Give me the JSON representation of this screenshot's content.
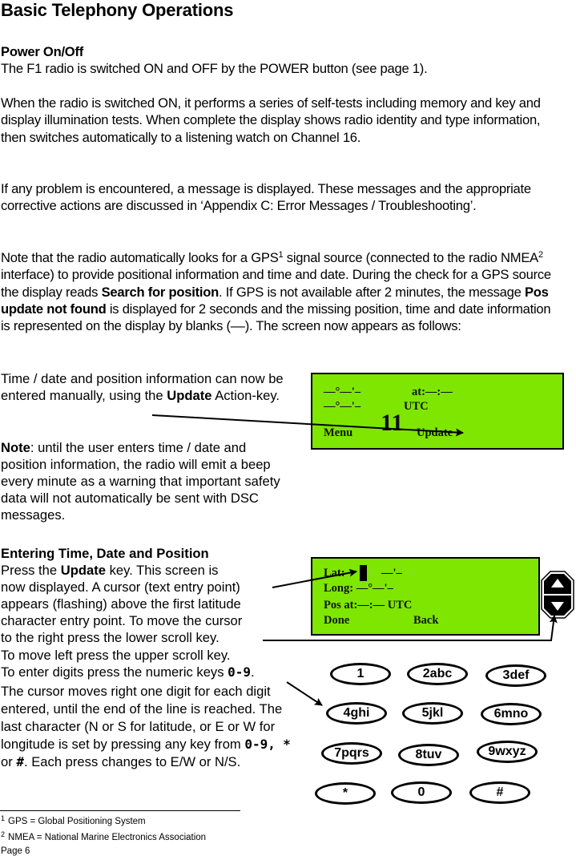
{
  "page": {
    "title": "Basic Telephony Operations",
    "page_number": "Page 6"
  },
  "power": {
    "heading": "Power On/Off",
    "p1": "The F1 radio is switched ON and OFF by the POWER button (see page 1).",
    "p2": "When the radio is switched ON, it performs a series of self-tests including memory and key and display illumination tests. When complete the display shows radio identity and type information, then switches automatically to a listening watch on Channel 16.",
    "p3": "If any problem is encountered, a message is displayed. These messages and the appropriate corrective actions are discussed in ‘Appendix C: Error Messages / Troubleshooting’.",
    "p4_a": "Note that the radio automatically looks for a GPS",
    "p4_sup1": "1",
    "p4_b": " signal source (connected to the radio NMEA",
    "p4_sup2": "2",
    "p4_c": " interface) to provide positional information and time and date. During the check for a GPS source the display reads ",
    "p4_bold1": "Search for position",
    "p4_d": ". If GPS is not available after 2 minutes, the message ",
    "p4_bold2": "Pos update not found",
    "p4_e": " is displayed for 2 seconds and the missing position, time and date information is represented on the display by blanks (––). The screen now appears as follows:"
  },
  "manual": {
    "p1_a": "Time / date and position information can now be entered manually, using the ",
    "p1_bold": "Update",
    "p1_b": " Action-key.",
    "note_bold": "Note",
    "note_text": ": until the user enters time / date and position information, the radio will emit a beep every minute as a warning that important safety data will not automatically be sent with DSC messages."
  },
  "entering": {
    "heading": "Entering Time, Date and Position",
    "line1_a": "Press the ",
    "line1_bold": "Update",
    "line1_b": " key. This screen is",
    "line2": "now displayed. A cursor (text entry point)",
    "line3": "appears (flashing) above the first latitude",
    "line4": "character entry point. To move the cursor",
    "line5": "to the right press the lower scroll key.",
    "line6": "To move left press the upper scroll key.",
    "line7_a": "To enter digits press the numeric keys ",
    "line7_mono": "0-9",
    "line7_b": ".",
    "p2_a": "The cursor moves right one digit for each digit entered, until the end of the line is reached. The last character (N or S for latitude, or E or W for longitude is set by pressing any key from ",
    "p2_mono1": "0-9,",
    "p2_mono2": "*",
    "p2_or": " or ",
    "p2_mono3": "#",
    "p2_b": ". Each press changes to E/W or N/S."
  },
  "lcd1": {
    "lat": "—°—'–",
    "at": "at:—:—",
    "long": "—°—'–",
    "utc": "UTC",
    "menu": "Menu",
    "channel": "11",
    "update": "Update"
  },
  "lcd2": {
    "lat_label": "Lat:",
    "lat_value": "—'–",
    "long_line": "Long:  —°—'–",
    "pos_line": "Pos at:—:— UTC",
    "done": "Done",
    "back": "Back"
  },
  "keypad": {
    "keys": [
      "1",
      "2abc",
      "3def",
      "4ghi",
      "5jkl",
      "6mno",
      "7pqrs",
      "8tuv",
      "9wxyz",
      "*",
      "0",
      "#"
    ]
  },
  "footnotes": [
    {
      "num": "1",
      "text": "GPS = Global Positioning System"
    },
    {
      "num": "2",
      "text": "NMEA = National Marine Electronics Association"
    }
  ],
  "colors": {
    "lcd_background": "#7ee600"
  }
}
